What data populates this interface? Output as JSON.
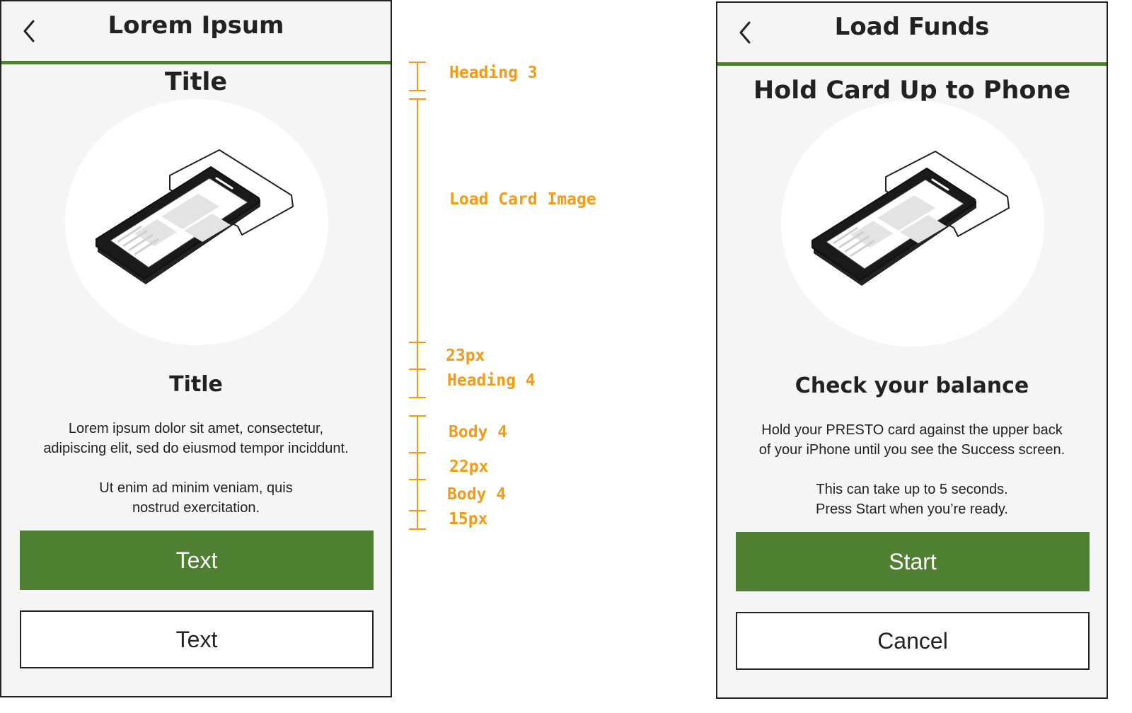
{
  "colors": {
    "accent": "#4f7f30",
    "annotation": "#f39b14",
    "border": "#222222",
    "screen_bg": "#f5f5f5"
  },
  "left_screen": {
    "header_title": "Lorem Ipsum",
    "title": "Title",
    "image_icon": "phone-with-card",
    "subtitle": "Title",
    "body": {
      "p1_line1": "Lorem ipsum dolor sit amet, consectetur,",
      "p1_line2": "adipiscing elit, sed do eiusmod tempor inciddunt.",
      "p2_line1": "Ut enim ad minim veniam, quis",
      "p2_line2": "nostrud exercitation."
    },
    "primary_button": "Text",
    "secondary_button": "Text"
  },
  "annotations": {
    "heading3": "Heading 3",
    "load_card_image": "Load Card Image",
    "gap_23": "23px",
    "heading4": "Heading 4",
    "body4_a": "Body 4",
    "gap_22": "22px",
    "body4_b": "Body 4",
    "gap_15": "15px"
  },
  "right_screen": {
    "header_title": "Load Funds",
    "title": "Hold Card Up to Phone",
    "image_icon": "phone-with-card",
    "subtitle": "Check your balance",
    "body": {
      "p1_line1": "Hold your PRESTO card against the upper back",
      "p1_line2": "of your iPhone until you see the Success screen.",
      "p2_line1": "This can take up to 5 seconds.",
      "p2_line2": "Press Start when you’re ready."
    },
    "primary_button": "Start",
    "secondary_button": "Cancel"
  }
}
